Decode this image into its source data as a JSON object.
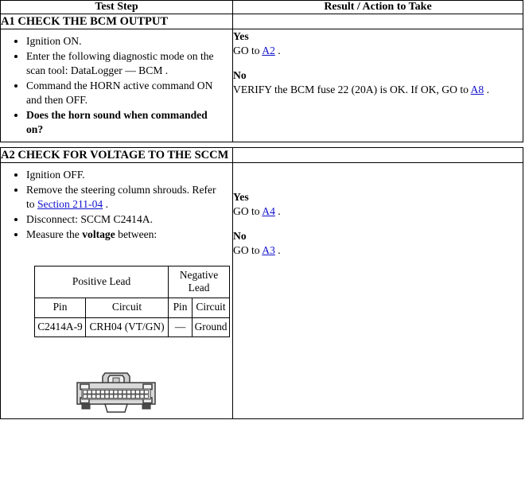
{
  "table": {
    "headers": {
      "test_step": "Test Step",
      "result_action": "Result / Action to Take"
    },
    "sections": [
      {
        "id": "A1",
        "title": "A1 CHECK THE BCM OUTPUT",
        "steps": [
          "Ignition ON.",
          "Enter the following diagnostic mode on the scan tool: DataLogger — BCM .",
          "Command the HORN active command ON and then OFF.",
          "Does the horn sound when commanded on?"
        ],
        "bold_steps": [
          false,
          false,
          false,
          true
        ],
        "result": {
          "yes_label": "Yes",
          "yes_text_before": "GO to ",
          "yes_link": "A2",
          "yes_text_after": " .",
          "no_label": "No",
          "no_text_before": "VERIFY the BCM fuse 22 (20A) is OK. If OK, GO to ",
          "no_link": "A8",
          "no_text_after": " ."
        }
      },
      {
        "id": "A2",
        "title": "A2 CHECK FOR VOLTAGE TO THE SCCM",
        "steps": [
          "Ignition OFF.",
          "Remove the steering column shrouds. Refer to ",
          "Disconnect: SCCM C2414A.",
          "Measure the "
        ],
        "step2_link": "Section 211-04",
        "step2_after": " .",
        "step4_bold": "voltage",
        "step4_after": " between:",
        "result": {
          "yes_label": "Yes",
          "yes_text_before": "GO to ",
          "yes_link": "A4",
          "yes_text_after": " .",
          "no_label": "No",
          "no_text_before": "GO to ",
          "no_link": "A3",
          "no_text_after": " ."
        },
        "lead_table": {
          "group_headers": [
            "Positive Lead",
            "Negative Lead"
          ],
          "sub_headers": [
            "Pin",
            "Circuit",
            "Pin",
            "Circuit"
          ],
          "rows": [
            [
              "C2414A-9",
              "CRH04 (VT/GN)",
              "—",
              "Ground"
            ]
          ]
        },
        "connector_image": "connector-pinout-graphic"
      }
    ]
  },
  "colors": {
    "link": "#1111cc",
    "border": "#000000",
    "text": "#000000",
    "background": "#ffffff",
    "connector_body": "#d9d9d9",
    "connector_outline": "#3a3a3a"
  }
}
